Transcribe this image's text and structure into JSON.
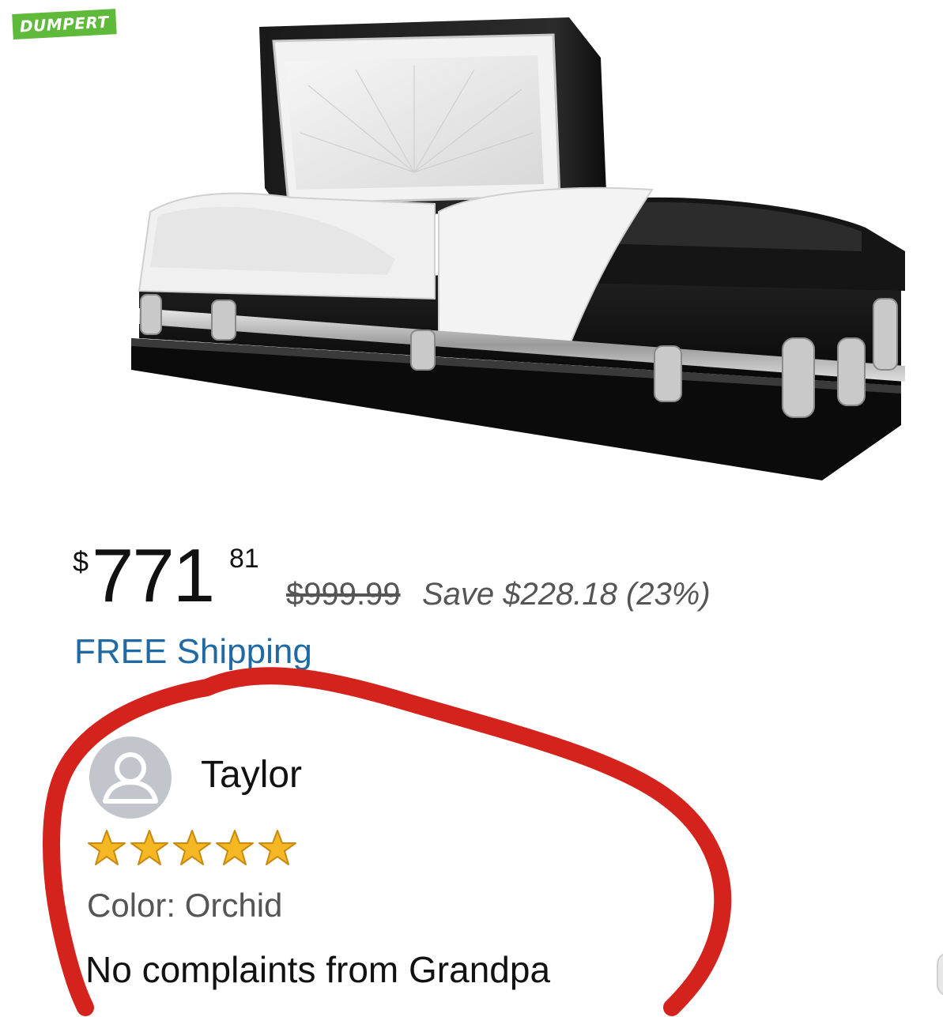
{
  "watermark": {
    "text": "DUMPERT"
  },
  "product": {
    "image_icon": "casket-image",
    "price": {
      "symbol": "$",
      "whole": "771",
      "fraction": "81"
    },
    "list_price": "$999.99",
    "savings": "Save $228.18 (23%)",
    "shipping": "FREE Shipping"
  },
  "review": {
    "avatar_icon": "user-avatar-icon",
    "name": "Taylor",
    "rating": 5,
    "rating_max": 5,
    "color": "Color: Orchid",
    "text": "No complaints from Grandpa"
  },
  "colors": {
    "accent_link": "#1f6aa5",
    "star": "#f5b723",
    "highlight_circle": "#d4221c",
    "watermark": "#5fb93a"
  }
}
